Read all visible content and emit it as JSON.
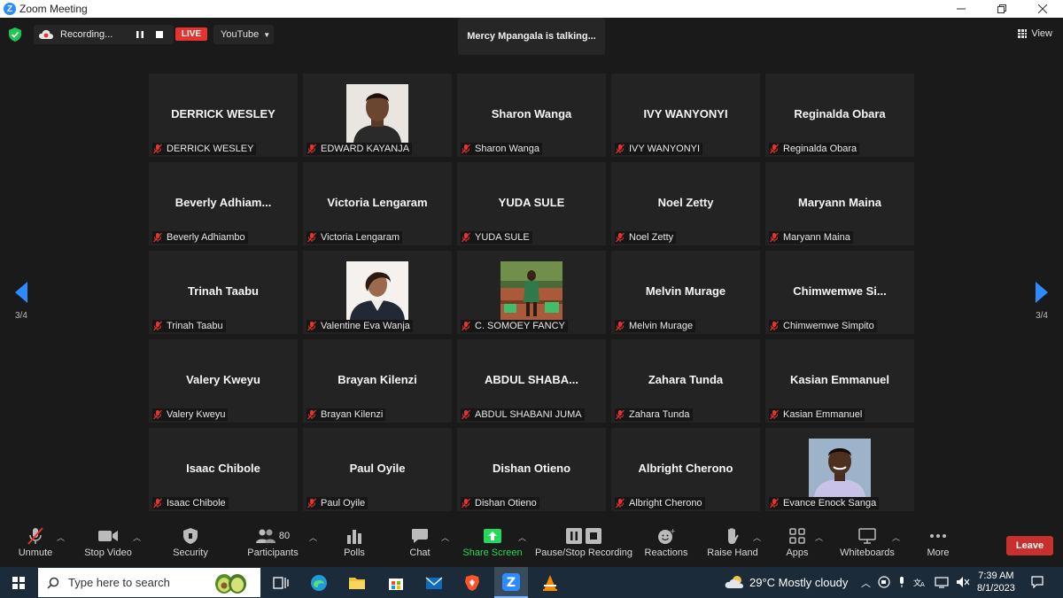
{
  "window": {
    "title": "Zoom Meeting"
  },
  "topbar": {
    "recording_label": "Recording...",
    "live_label": "LIVE",
    "stream_target": "YouTube",
    "speaker_status": "Mercy Mpangala is talking...",
    "view_label": "View"
  },
  "navigation": {
    "page_left": "3/4",
    "page_right": "3/4"
  },
  "participants": [
    {
      "display": "DERRICK WESLEY",
      "label": "DERRICK WESLEY",
      "photo": false
    },
    {
      "display": "",
      "label": "EDWARD KAYANJA",
      "photo": true
    },
    {
      "display": "Sharon Wanga",
      "label": "Sharon Wanga",
      "photo": false
    },
    {
      "display": "IVY WANYONYI",
      "label": "IVY WANYONYI",
      "photo": false
    },
    {
      "display": "Reginalda Obara",
      "label": "Reginalda Obara",
      "photo": false
    },
    {
      "display": "Beverly  Adhiam...",
      "label": "Beverly Adhiambo",
      "photo": false
    },
    {
      "display": "Victoria Lengaram",
      "label": "Victoria Lengaram",
      "photo": false
    },
    {
      "display": "YUDA SULE",
      "label": "YUDA SULE",
      "photo": false
    },
    {
      "display": "Noel Zetty",
      "label": "Noel Zetty",
      "photo": false
    },
    {
      "display": "Maryann Maina",
      "label": "Maryann Maina",
      "photo": false
    },
    {
      "display": "Trinah Taabu",
      "label": "Trinah Taabu",
      "photo": false
    },
    {
      "display": "",
      "label": "Valentine Eva Wanja",
      "photo": true
    },
    {
      "display": "",
      "label": "C. SOMOEY FANCY",
      "photo": true
    },
    {
      "display": "Melvin Murage",
      "label": "Melvin Murage",
      "photo": false
    },
    {
      "display": "Chimwemwe  Si...",
      "label": "Chimwemwe Simpito",
      "photo": false
    },
    {
      "display": "Valery Kweyu",
      "label": "Valery Kweyu",
      "photo": false
    },
    {
      "display": "Brayan Kilenzi",
      "label": "Brayan Kilenzi",
      "photo": false
    },
    {
      "display": "ABDUL  SHABA...",
      "label": "ABDUL SHABANI JUMA",
      "photo": false
    },
    {
      "display": "Zahara Tunda",
      "label": "Zahara Tunda",
      "photo": false
    },
    {
      "display": "Kasian Emmanuel",
      "label": "Kasian Emmanuel",
      "photo": false
    },
    {
      "display": "Isaac Chibole",
      "label": "Isaac Chibole",
      "photo": false
    },
    {
      "display": "Paul Oyile",
      "label": "Paul Oyile",
      "photo": false
    },
    {
      "display": "Dishan Otieno",
      "label": "Dishan Otieno",
      "photo": false
    },
    {
      "display": "Albright Cherono",
      "label": "Albright Cherono",
      "photo": false
    },
    {
      "display": "",
      "label": "Evance Enock Sanga",
      "photo": true
    }
  ],
  "toolbar": {
    "unmute": "Unmute",
    "stop_video": "Stop Video",
    "security": "Security",
    "participants": "Participants",
    "participant_count": "80",
    "polls": "Polls",
    "chat": "Chat",
    "share_screen": "Share Screen",
    "pause_recording": "Pause/Stop Recording",
    "reactions": "Reactions",
    "raise_hand": "Raise Hand",
    "apps": "Apps",
    "whiteboards": "Whiteboards",
    "more": "More",
    "leave": "Leave"
  },
  "taskbar": {
    "search_placeholder": "Type here to search",
    "weather": "29°C  Mostly cloudy",
    "time": "7:39 AM",
    "date": "8/1/2023"
  },
  "colors": {
    "share_green": "#23d959",
    "leave_red": "#c8302d",
    "live_red": "#e5332f",
    "zoom_blue": "#2d8cff",
    "nav_blue": "#2d8cff"
  }
}
